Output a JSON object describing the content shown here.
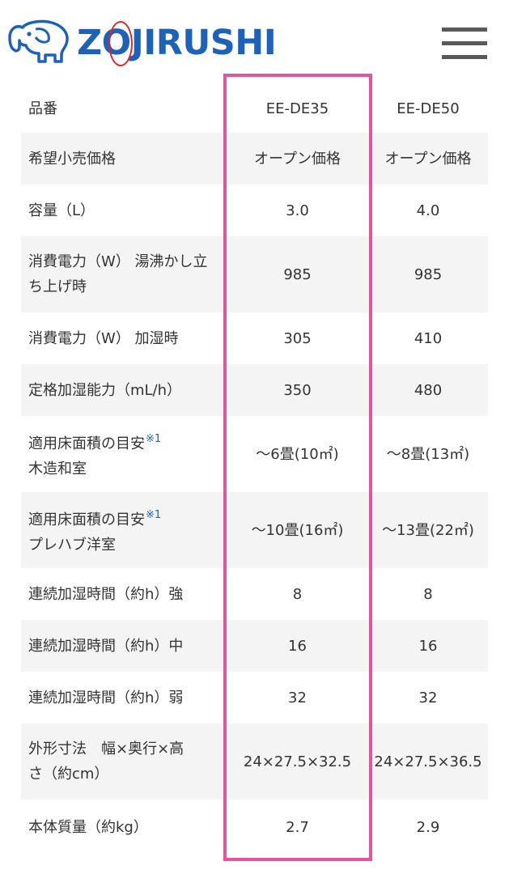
{
  "header": {
    "brand": "ZOJIRUSHI",
    "elephant_icon": "elephant-logo-icon",
    "menu_icon": "hamburger-menu-icon"
  },
  "colors": {
    "brand_blue": "#1d61b8",
    "brand_red": "#d9282f",
    "highlight": "#e0559b",
    "row_stripe": "#f4f4f4"
  },
  "table": {
    "header_label": "品番",
    "models": [
      "EE-DE35",
      "EE-DE50"
    ],
    "rows": [
      {
        "label": "希望小売価格",
        "v1": "オープン価格",
        "v2": "オープン価格"
      },
      {
        "label": "容量（L）",
        "v1": "3.0",
        "v2": "4.0"
      },
      {
        "label_line1": "消費電力（W） 湯沸かし立",
        "label_line2": "ち上げ時",
        "v1": "985",
        "v2": "985"
      },
      {
        "label": "消費電力（W） 加湿時",
        "v1": "305",
        "v2": "410"
      },
      {
        "label": "定格加湿能力（mL/h）",
        "v1": "350",
        "v2": "480"
      },
      {
        "label_line1": "適用床面積の目安",
        "note": "※1",
        "label_line2": "木造和室",
        "v1": "～6畳(10㎡)",
        "v2": "～8畳(13㎡)"
      },
      {
        "label_line1": "適用床面積の目安",
        "note": "※1",
        "label_line2": "プレハブ洋室",
        "v1": "～10畳(16㎡)",
        "v2": "～13畳(22㎡)"
      },
      {
        "label": "連続加湿時間（約h）強",
        "v1": "8",
        "v2": "8"
      },
      {
        "label": "連続加湿時間（約h）中",
        "v1": "16",
        "v2": "16"
      },
      {
        "label": "連続加湿時間（約h）弱",
        "v1": "32",
        "v2": "32"
      },
      {
        "label_line1": "外形寸法　幅×奥行×高",
        "label_line2": "さ（約cm）",
        "v1": "24×27.5×32.5",
        "v2": "24×27.5×36.5"
      },
      {
        "label": "本体質量（約kg）",
        "v1": "2.7",
        "v2": "2.9"
      }
    ]
  }
}
